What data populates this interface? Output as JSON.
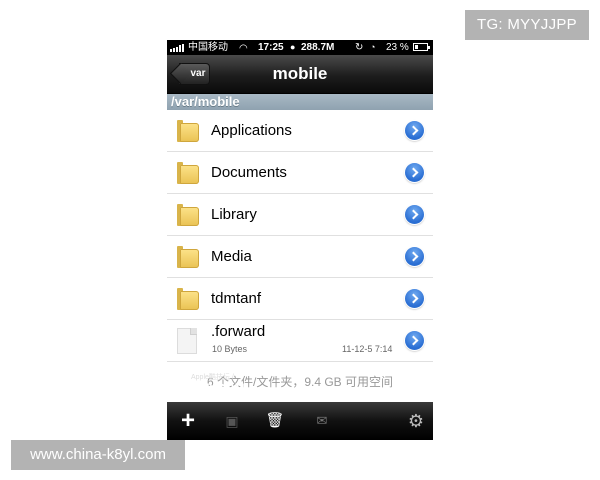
{
  "watermarks": {
    "top_right": "TG: MYYJJPP",
    "bottom_left": "www.china-k8yl.com",
    "ifan": "iFan.178.COM",
    "apple_site": "Apple酷技坛 /"
  },
  "status_bar": {
    "carrier": "中国移动",
    "time": "17:25",
    "memory": "288.7M",
    "battery": "23 %"
  },
  "nav": {
    "back_label": "var",
    "title": "mobile"
  },
  "path": "/var/mobile",
  "items": [
    {
      "name": "Applications",
      "type": "folder"
    },
    {
      "name": "Documents",
      "type": "folder"
    },
    {
      "name": "Library",
      "type": "folder"
    },
    {
      "name": "Media",
      "type": "folder"
    },
    {
      "name": "tdmtanf",
      "type": "folder"
    },
    {
      "name": ".forward",
      "type": "file",
      "size": "10 Bytes",
      "date": "11-12-5 7:14"
    }
  ],
  "footer": "6 个文件/文件夹，9.4 GB 可用空间",
  "toolbar": {
    "add": "+",
    "trash": "🗑",
    "mail": "✉",
    "gear": "⚙"
  },
  "icons": [
    "signal-icon",
    "wifi-icon",
    "apple-icon",
    "lock-rotation-icon",
    "alarm-icon",
    "battery-icon",
    "folder-icon",
    "file-icon",
    "disclosure-icon",
    "add-icon",
    "copy-icon",
    "trash-icon",
    "mail-icon",
    "gear-icon"
  ]
}
